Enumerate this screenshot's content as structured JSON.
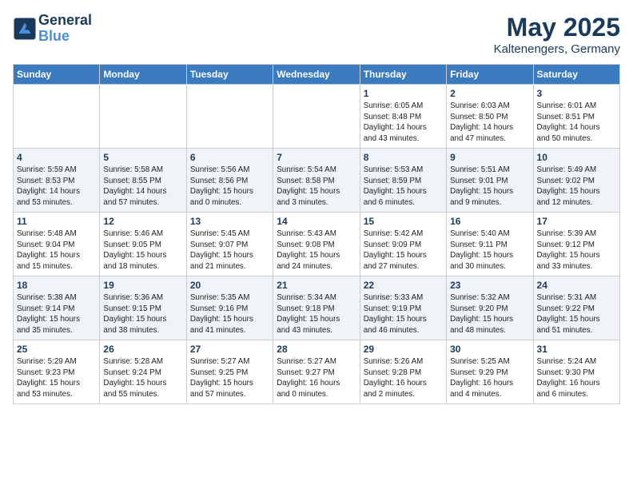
{
  "header": {
    "logo_line1": "General",
    "logo_line2": "Blue",
    "month": "May 2025",
    "location": "Kaltenengers, Germany"
  },
  "weekdays": [
    "Sunday",
    "Monday",
    "Tuesday",
    "Wednesday",
    "Thursday",
    "Friday",
    "Saturday"
  ],
  "weeks": [
    [
      {
        "day": "",
        "info": ""
      },
      {
        "day": "",
        "info": ""
      },
      {
        "day": "",
        "info": ""
      },
      {
        "day": "",
        "info": ""
      },
      {
        "day": "1",
        "info": "Sunrise: 6:05 AM\nSunset: 8:48 PM\nDaylight: 14 hours\nand 43 minutes."
      },
      {
        "day": "2",
        "info": "Sunrise: 6:03 AM\nSunset: 8:50 PM\nDaylight: 14 hours\nand 47 minutes."
      },
      {
        "day": "3",
        "info": "Sunrise: 6:01 AM\nSunset: 8:51 PM\nDaylight: 14 hours\nand 50 minutes."
      }
    ],
    [
      {
        "day": "4",
        "info": "Sunrise: 5:59 AM\nSunset: 8:53 PM\nDaylight: 14 hours\nand 53 minutes."
      },
      {
        "day": "5",
        "info": "Sunrise: 5:58 AM\nSunset: 8:55 PM\nDaylight: 14 hours\nand 57 minutes."
      },
      {
        "day": "6",
        "info": "Sunrise: 5:56 AM\nSunset: 8:56 PM\nDaylight: 15 hours\nand 0 minutes."
      },
      {
        "day": "7",
        "info": "Sunrise: 5:54 AM\nSunset: 8:58 PM\nDaylight: 15 hours\nand 3 minutes."
      },
      {
        "day": "8",
        "info": "Sunrise: 5:53 AM\nSunset: 8:59 PM\nDaylight: 15 hours\nand 6 minutes."
      },
      {
        "day": "9",
        "info": "Sunrise: 5:51 AM\nSunset: 9:01 PM\nDaylight: 15 hours\nand 9 minutes."
      },
      {
        "day": "10",
        "info": "Sunrise: 5:49 AM\nSunset: 9:02 PM\nDaylight: 15 hours\nand 12 minutes."
      }
    ],
    [
      {
        "day": "11",
        "info": "Sunrise: 5:48 AM\nSunset: 9:04 PM\nDaylight: 15 hours\nand 15 minutes."
      },
      {
        "day": "12",
        "info": "Sunrise: 5:46 AM\nSunset: 9:05 PM\nDaylight: 15 hours\nand 18 minutes."
      },
      {
        "day": "13",
        "info": "Sunrise: 5:45 AM\nSunset: 9:07 PM\nDaylight: 15 hours\nand 21 minutes."
      },
      {
        "day": "14",
        "info": "Sunrise: 5:43 AM\nSunset: 9:08 PM\nDaylight: 15 hours\nand 24 minutes."
      },
      {
        "day": "15",
        "info": "Sunrise: 5:42 AM\nSunset: 9:09 PM\nDaylight: 15 hours\nand 27 minutes."
      },
      {
        "day": "16",
        "info": "Sunrise: 5:40 AM\nSunset: 9:11 PM\nDaylight: 15 hours\nand 30 minutes."
      },
      {
        "day": "17",
        "info": "Sunrise: 5:39 AM\nSunset: 9:12 PM\nDaylight: 15 hours\nand 33 minutes."
      }
    ],
    [
      {
        "day": "18",
        "info": "Sunrise: 5:38 AM\nSunset: 9:14 PM\nDaylight: 15 hours\nand 35 minutes."
      },
      {
        "day": "19",
        "info": "Sunrise: 5:36 AM\nSunset: 9:15 PM\nDaylight: 15 hours\nand 38 minutes."
      },
      {
        "day": "20",
        "info": "Sunrise: 5:35 AM\nSunset: 9:16 PM\nDaylight: 15 hours\nand 41 minutes."
      },
      {
        "day": "21",
        "info": "Sunrise: 5:34 AM\nSunset: 9:18 PM\nDaylight: 15 hours\nand 43 minutes."
      },
      {
        "day": "22",
        "info": "Sunrise: 5:33 AM\nSunset: 9:19 PM\nDaylight: 15 hours\nand 46 minutes."
      },
      {
        "day": "23",
        "info": "Sunrise: 5:32 AM\nSunset: 9:20 PM\nDaylight: 15 hours\nand 48 minutes."
      },
      {
        "day": "24",
        "info": "Sunrise: 5:31 AM\nSunset: 9:22 PM\nDaylight: 15 hours\nand 51 minutes."
      }
    ],
    [
      {
        "day": "25",
        "info": "Sunrise: 5:29 AM\nSunset: 9:23 PM\nDaylight: 15 hours\nand 53 minutes."
      },
      {
        "day": "26",
        "info": "Sunrise: 5:28 AM\nSunset: 9:24 PM\nDaylight: 15 hours\nand 55 minutes."
      },
      {
        "day": "27",
        "info": "Sunrise: 5:27 AM\nSunset: 9:25 PM\nDaylight: 15 hours\nand 57 minutes."
      },
      {
        "day": "28",
        "info": "Sunrise: 5:27 AM\nSunset: 9:27 PM\nDaylight: 16 hours\nand 0 minutes."
      },
      {
        "day": "29",
        "info": "Sunrise: 5:26 AM\nSunset: 9:28 PM\nDaylight: 16 hours\nand 2 minutes."
      },
      {
        "day": "30",
        "info": "Sunrise: 5:25 AM\nSunset: 9:29 PM\nDaylight: 16 hours\nand 4 minutes."
      },
      {
        "day": "31",
        "info": "Sunrise: 5:24 AM\nSunset: 9:30 PM\nDaylight: 16 hours\nand 6 minutes."
      }
    ]
  ]
}
